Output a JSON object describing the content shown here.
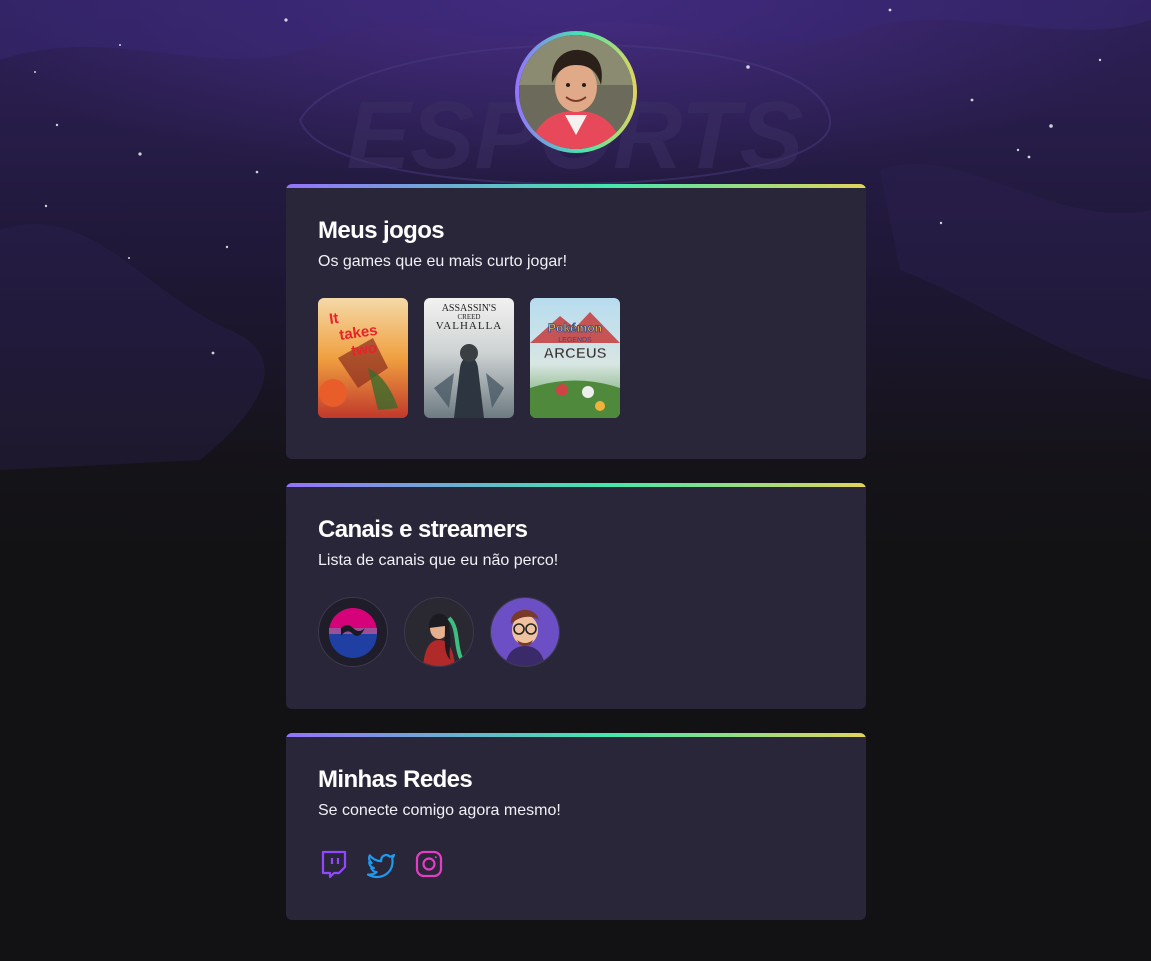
{
  "background": {
    "watermark_text": "ESPORTS"
  },
  "profile": {
    "avatar_alt": "avatar"
  },
  "games_section": {
    "title": "Meus jogos",
    "subtitle": "Os games que eu mais curto jogar!",
    "games": [
      {
        "name": "It Takes Two",
        "cover_text": "It takes two"
      },
      {
        "name": "Assassin's Creed Valhalla",
        "cover_text_1": "ASSASSIN'S",
        "cover_text_2": "CREED",
        "cover_text_3": "VALHALLA"
      },
      {
        "name": "Pokémon Legends: Arceus",
        "cover_text_1": "Pokémon",
        "cover_text_2": "LEGENDS",
        "cover_text_3": "ARCEUS"
      }
    ]
  },
  "channels_section": {
    "title": "Canais e streamers",
    "subtitle": "Lista de canais que eu não perco!",
    "channels": [
      {
        "icon": "channel-avatar-1"
      },
      {
        "icon": "channel-avatar-2"
      },
      {
        "icon": "channel-avatar-3"
      }
    ]
  },
  "socials_section": {
    "title": "Minhas Redes",
    "subtitle": "Se conecte comigo agora mesmo!",
    "links": [
      {
        "icon": "twitch-icon",
        "color": "#9146ff"
      },
      {
        "icon": "twitter-icon",
        "color": "#1d9bf0"
      },
      {
        "icon": "instagram-icon",
        "color": "#e63cc4"
      }
    ]
  },
  "colors": {
    "page_bg": "#121214",
    "card_bg": "#29263a",
    "gradient_start": "#9572fc",
    "gradient_mid": "#43e7ad",
    "gradient_end": "#e2d45c"
  }
}
